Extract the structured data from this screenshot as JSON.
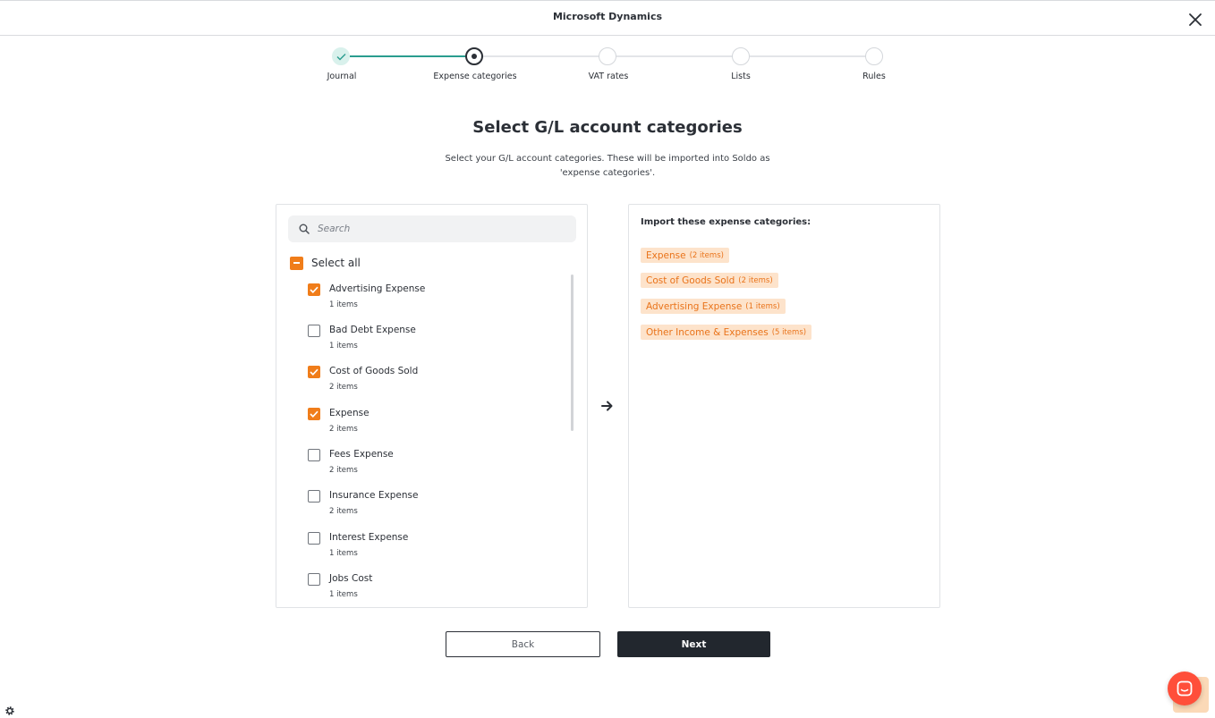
{
  "header": {
    "title": "Microsoft Dynamics"
  },
  "stepper": {
    "steps": [
      {
        "label": "Journal",
        "state": "completed"
      },
      {
        "label": "Expense categories",
        "state": "current"
      },
      {
        "label": "VAT rates",
        "state": "upcoming"
      },
      {
        "label": "Lists",
        "state": "upcoming"
      },
      {
        "label": "Rules",
        "state": "upcoming"
      }
    ]
  },
  "main": {
    "title": "Select G/L account categories",
    "subtitle": "Select your G/L account categories. These will be imported into Soldo as 'expense categories'."
  },
  "left_panel": {
    "search_placeholder": "Search",
    "select_all_label": "Select all",
    "items": [
      {
        "label": "Advertising Expense",
        "count": "1 items",
        "checked": true
      },
      {
        "label": "Bad Debt Expense",
        "count": "1 items",
        "checked": false
      },
      {
        "label": "Cost of Goods Sold",
        "count": "2 items",
        "checked": true
      },
      {
        "label": "Expense",
        "count": "2 items",
        "checked": true
      },
      {
        "label": "Fees Expense",
        "count": "2 items",
        "checked": false
      },
      {
        "label": "Insurance Expense",
        "count": "2 items",
        "checked": false
      },
      {
        "label": "Interest Expense",
        "count": "1 items",
        "checked": false
      },
      {
        "label": "Jobs Cost",
        "count": "1 items",
        "checked": false
      }
    ]
  },
  "right_panel": {
    "title": "Import these expense categories:",
    "tags": [
      {
        "name": "Expense",
        "count": "(2 items)"
      },
      {
        "name": "Cost of Goods Sold",
        "count": "(2 items)"
      },
      {
        "name": "Advertising Expense",
        "count": "(1 items)"
      },
      {
        "name": "Other Income & Expenses",
        "count": "(5 items)"
      }
    ]
  },
  "footer": {
    "back_label": "Back",
    "next_label": "Next"
  },
  "colors": {
    "accent": "#f07d1a",
    "teal": "#2a9d8f",
    "dark": "#22272e",
    "chat": "#ff4f3a"
  }
}
